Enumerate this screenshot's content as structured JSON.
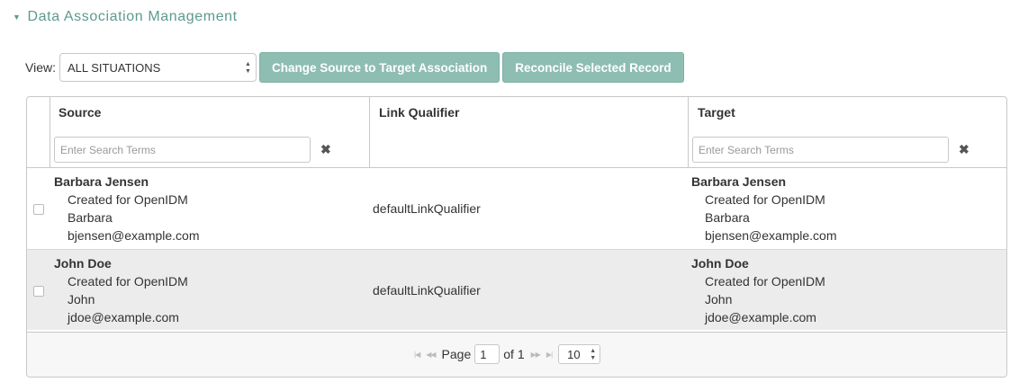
{
  "section": {
    "title": "Data Association Management"
  },
  "toolbar": {
    "view_label": "View:",
    "view_value": "ALL SITUATIONS",
    "change_button": "Change Source to Target Association",
    "reconcile_button": "Reconcile Selected Record"
  },
  "grid": {
    "columns": {
      "source": "Source",
      "link_qualifier": "Link Qualifier",
      "target": "Target"
    },
    "search_placeholder": "Enter Search Terms",
    "rows": [
      {
        "source": {
          "name": "Barbara Jensen",
          "description": "Created for OpenIDM",
          "given_name": "Barbara",
          "email": "bjensen@example.com"
        },
        "link_qualifier": "defaultLinkQualifier",
        "target": {
          "name": "Barbara Jensen",
          "description": "Created for OpenIDM",
          "given_name": "Barbara",
          "email": "bjensen@example.com"
        }
      },
      {
        "source": {
          "name": "John Doe",
          "description": "Created for OpenIDM",
          "given_name": "John",
          "email": "jdoe@example.com"
        },
        "link_qualifier": "defaultLinkQualifier",
        "target": {
          "name": "John Doe",
          "description": "Created for OpenIDM",
          "given_name": "John",
          "email": "jdoe@example.com"
        }
      }
    ]
  },
  "pager": {
    "page_label": "Page",
    "page_value": "1",
    "of_label": "of 1",
    "page_size": "10"
  }
}
